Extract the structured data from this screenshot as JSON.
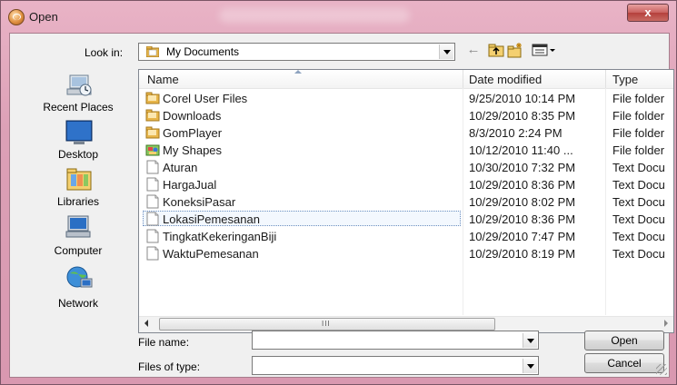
{
  "window": {
    "title": "Open",
    "close_glyph": "x"
  },
  "toolbar": {
    "look_in_label": "Look in:",
    "look_in_value": "My Documents",
    "back_icon": "back-arrow-icon",
    "up_icon": "up-folder-icon",
    "new_folder_icon": "new-folder-icon",
    "views_icon": "views-menu-icon"
  },
  "places": [
    {
      "label": "Recent Places",
      "icon": "recent-places-icon"
    },
    {
      "label": "Desktop",
      "icon": "desktop-icon"
    },
    {
      "label": "Libraries",
      "icon": "libraries-icon"
    },
    {
      "label": "Computer",
      "icon": "computer-icon"
    },
    {
      "label": "Network",
      "icon": "network-icon"
    }
  ],
  "columns": {
    "name": "Name",
    "date": "Date modified",
    "type": "Type"
  },
  "files": [
    {
      "name": "Corel User Files",
      "date": "9/25/2010 10:14 PM",
      "type": "File folder",
      "icon": "folder"
    },
    {
      "name": "Downloads",
      "date": "10/29/2010 8:35 PM",
      "type": "File folder",
      "icon": "folder"
    },
    {
      "name": "GomPlayer",
      "date": "8/3/2010 2:24 PM",
      "type": "File folder",
      "icon": "folder"
    },
    {
      "name": "My Shapes",
      "date": "10/12/2010 11:40 ...",
      "type": "File folder",
      "icon": "shapes-folder"
    },
    {
      "name": "Aturan",
      "date": "10/30/2010 7:32 PM",
      "type": "Text Docu",
      "icon": "document"
    },
    {
      "name": "HargaJual",
      "date": "10/29/2010 8:36 PM",
      "type": "Text Docu",
      "icon": "document"
    },
    {
      "name": "KoneksiPasar",
      "date": "10/29/2010 8:02 PM",
      "type": "Text Docu",
      "icon": "document"
    },
    {
      "name": "LokasiPemesanan",
      "date": "10/29/2010 8:36 PM",
      "type": "Text Docu",
      "icon": "document",
      "focused": true
    },
    {
      "name": "TingkatKekeringanBiji",
      "date": "10/29/2010 7:47 PM",
      "type": "Text Docu",
      "icon": "document"
    },
    {
      "name": "WaktuPemesanan",
      "date": "10/29/2010 8:19 PM",
      "type": "Text Docu",
      "icon": "document"
    }
  ],
  "scrollbar": {
    "grip": "III"
  },
  "form": {
    "file_name_label": "File name:",
    "file_name_value": "",
    "files_of_type_label": "Files of type:",
    "files_of_type_value": ""
  },
  "buttons": {
    "open": "Open",
    "cancel": "Cancel"
  },
  "colors": {
    "title_bar": "#dca0b6",
    "close_button": "#c9605e",
    "folder": "#e8b64a",
    "window_bg": "#f0f0f0"
  }
}
